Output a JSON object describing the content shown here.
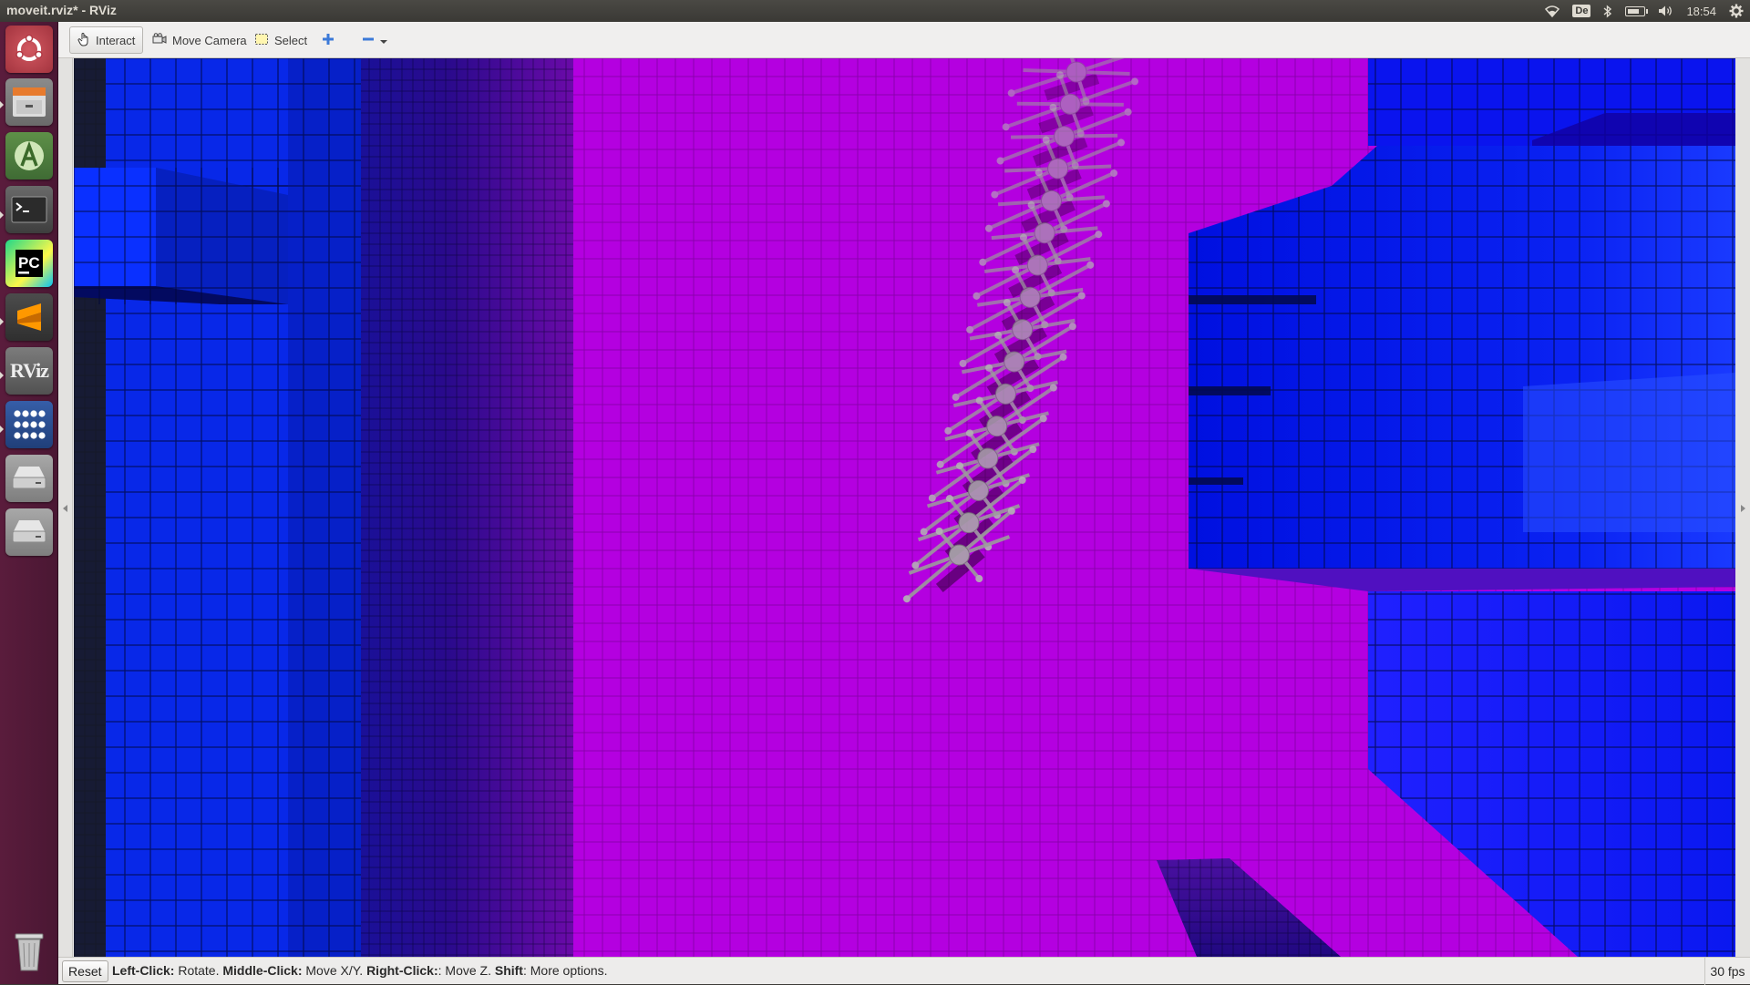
{
  "window": {
    "title": "moveit.rviz* - RViz"
  },
  "top_panel": {
    "indicators": [
      {
        "name": "wifi-icon"
      },
      {
        "name": "keyboard-layout",
        "text": "De"
      },
      {
        "name": "bluetooth-icon"
      },
      {
        "name": "battery-icon"
      },
      {
        "name": "volume-icon"
      },
      {
        "name": "clock",
        "text": "18:54"
      },
      {
        "name": "settings-gear-icon"
      }
    ]
  },
  "launcher": {
    "items": [
      {
        "name": "ubuntu-dash-icon",
        "color": "#c24a55"
      },
      {
        "name": "files-icon",
        "color": "#e3772f"
      },
      {
        "name": "android-studio-icon",
        "color": "#4a7c3f"
      },
      {
        "name": "terminal-icon",
        "color": "#2c2c2c"
      },
      {
        "name": "pycharm-icon",
        "color": "#21d789"
      },
      {
        "name": "sublime-text-icon",
        "color": "#d8792a"
      },
      {
        "name": "rviz-icon",
        "color": "#5b5b5b",
        "text": "RViz"
      },
      {
        "name": "app-grid-icon",
        "color": "#2b4a8c"
      },
      {
        "name": "drive-icon",
        "color": "#bdbdbd"
      },
      {
        "name": "drive-icon-2",
        "color": "#bdbdbd"
      },
      {
        "name": "trash-icon",
        "color": "#9a9a9a"
      }
    ]
  },
  "toolbar": {
    "interact": "Interact",
    "move_camera": "Move Camera",
    "select": "Select"
  },
  "statusbar": {
    "reset": "Reset",
    "hint": {
      "lc_key": "Left-Click:",
      "lc_val": " Rotate. ",
      "mc_key": "Middle-Click:",
      "mc_val": " Move X/Y. ",
      "rc_key": "Right-Click:",
      "rc_val": ": Move Z. ",
      "sh_key": "Shift",
      "sh_val": ": More options."
    },
    "fps": "30 fps"
  },
  "colors": {
    "background_magenta": "#b400e0",
    "voxel_blue": "#0a1ef0",
    "launcher_bg": "#5a1c3c"
  }
}
